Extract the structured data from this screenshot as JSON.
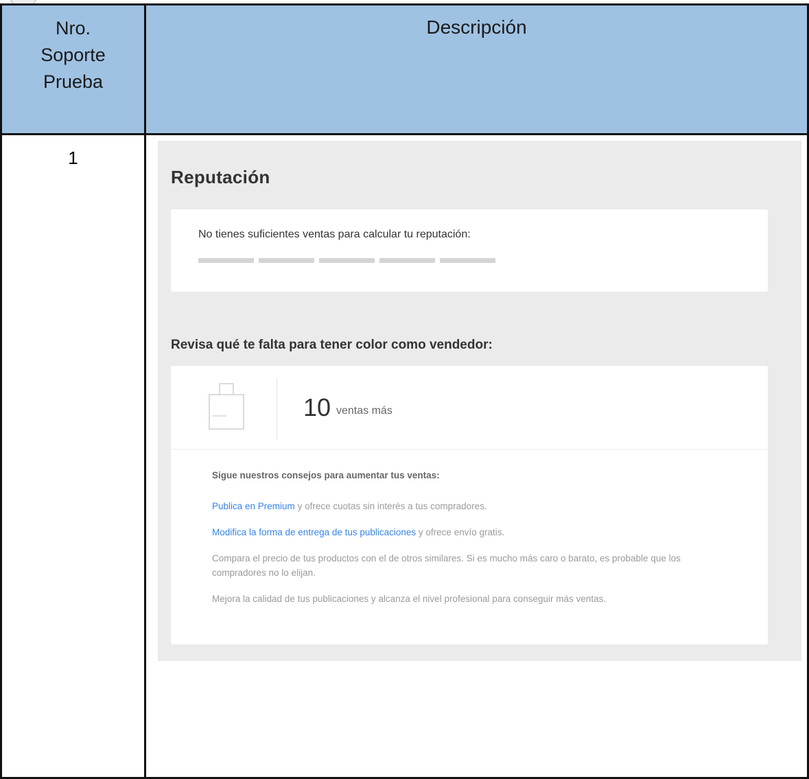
{
  "table": {
    "header_num": [
      "Nro.",
      "Soporte",
      "Prueba"
    ],
    "header_desc": "Descripción",
    "row_num": "1"
  },
  "screenshot": {
    "title": "Reputación",
    "no_sales_text": "No tienes suficientes ventas para calcular tu reputación:",
    "thermometer_segments": 5,
    "section_title": "Revisa qué te falta para tener color como vendedor:",
    "sales_count": "10",
    "sales_label": "ventas más",
    "tips_intro": "Sigue nuestros consejos para aumentar tus ventas:",
    "tips": [
      {
        "link": "Publica en Premium",
        "text": " y ofrece cuotas sin interés a tus compradores."
      },
      {
        "link": "Modifica la forma de entrega de tus publicaciones",
        "text": " y ofrece envío gratis."
      },
      {
        "link": "",
        "text": "Compara el precio de tus productos con el de otros similares. Si es mucho más caro o barato, es probable que los compradores no lo elijan."
      },
      {
        "link": "",
        "text": "Mejora la calidad de tus publicaciones y alcanza el nivel profesional para conseguir más ventas."
      }
    ],
    "colors": {
      "link": "#3483fa",
      "header_bg": "#9fc2e3",
      "panel_bg": "#ebebeb"
    },
    "icon": "shopping-bag-icon"
  }
}
